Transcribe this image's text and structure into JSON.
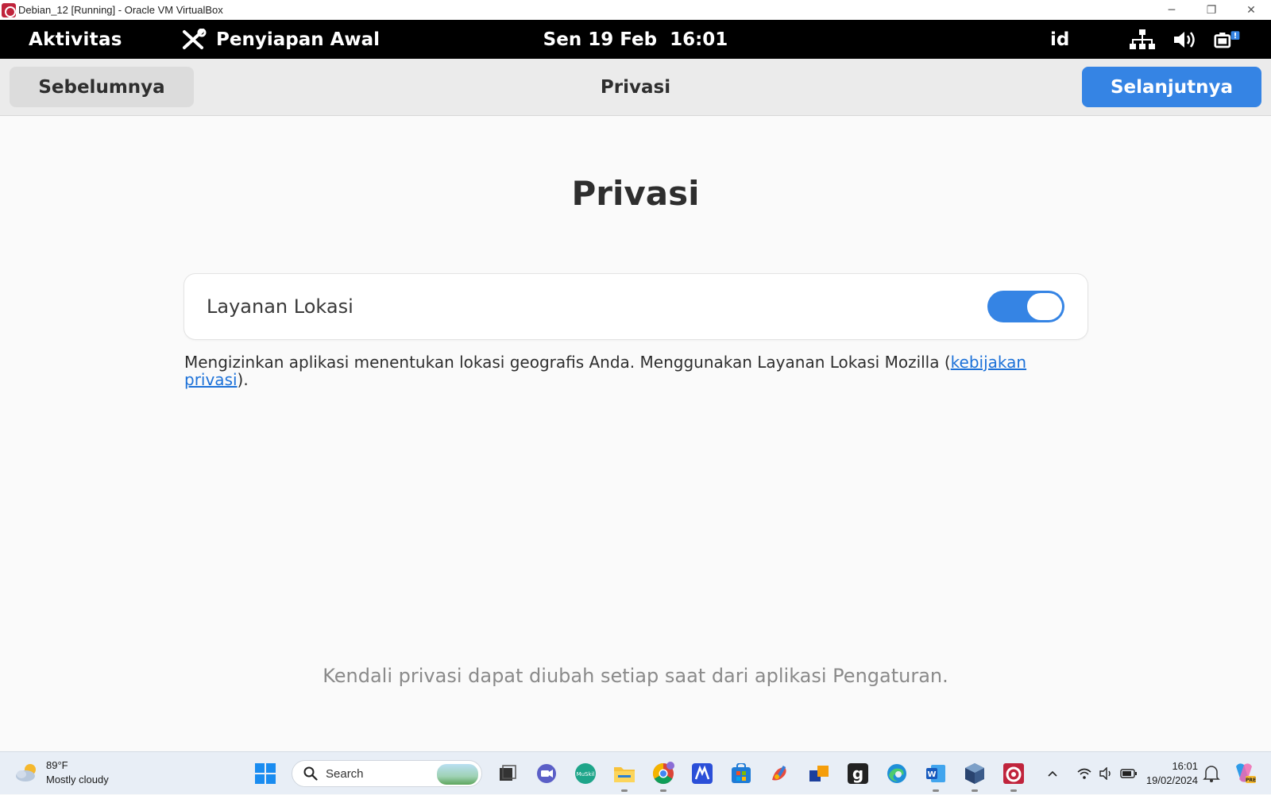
{
  "vbox": {
    "title": "Debian_12 [Running] - Oracle VM VirtualBox",
    "minimize_glyph": "─",
    "restore_glyph": "❐",
    "close_glyph": "✕"
  },
  "gnome_topbar": {
    "activities_label": "Aktivitas",
    "app_label": "Penyiapan Awal",
    "clock": "Sen 19 Feb  16:01",
    "keyboard_lang": "id",
    "tray_icons": [
      "network-wired-icon",
      "volume-icon",
      "battery-icon"
    ]
  },
  "headerbar": {
    "prev_label": "Sebelumnya",
    "title": "Privasi",
    "next_label": "Selanjutnya"
  },
  "main": {
    "heading": "Privasi",
    "location_service": {
      "label": "Layanan Lokasi",
      "enabled": true
    },
    "description_text": "Mengizinkan aplikasi menentukan lokasi geografis Anda. Menggunakan Layanan Lokasi Mozilla (",
    "description_link": "kebijakan privasi",
    "description_end": ").",
    "footer_note": "Kendali privasi dapat diubah setiap saat dari aplikasi Pengaturan."
  },
  "taskbar": {
    "weather_temp": "89°F",
    "weather_desc": "Mostly cloudy",
    "search_placeholder": "Search",
    "time": "16:01",
    "date": "19/02/2024",
    "pinned_apps": [
      "windows-start",
      "search",
      "task-view",
      "teams-chat",
      "musik-app",
      "file-explorer",
      "chrome",
      "m365-app",
      "microsoft-store",
      "paint-app",
      "sticky-app",
      "goodnotes-app",
      "edge",
      "word",
      "virtualbox",
      "debian-vm"
    ],
    "colors": {
      "accent": "#3584e4"
    }
  }
}
